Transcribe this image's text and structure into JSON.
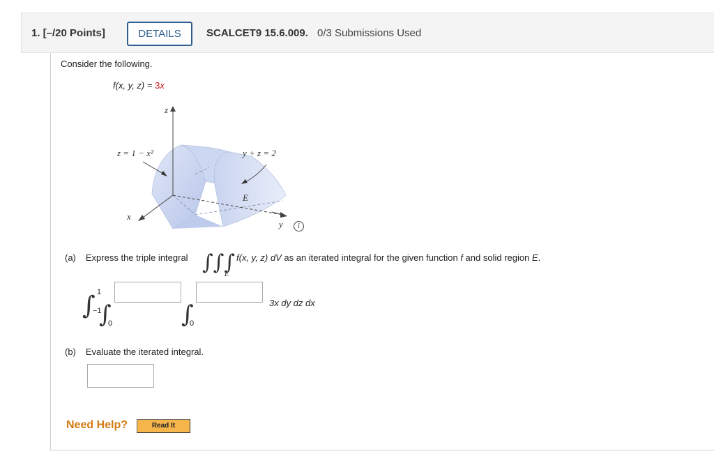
{
  "header": {
    "question_number": "1.  [–/20 Points]",
    "details_label": "DETAILS",
    "problem_code": "SCALCET9 15.6.009.",
    "submissions": "0/3 Submissions Used"
  },
  "prompt": {
    "intro": "Consider the following.",
    "function_lhs": "f(x, y, z) = ",
    "function_coef": "3",
    "function_var": "x"
  },
  "figure": {
    "axis_z": "z",
    "axis_x": "x",
    "axis_y": "y",
    "surface1": "z = 1 − x²",
    "surface2": "y + z = 2",
    "region": "E",
    "info_icon": "info-icon"
  },
  "part_a": {
    "label": "(a)",
    "text_before": "Express the triple integral",
    "region_sub": "E",
    "text_after_italic": "f(x, y, z) dV",
    "text_after": " as an iterated integral for the given function ",
    "f": "f",
    "text_and": " and solid region ",
    "E": "E",
    "period": ".",
    "outer_upper": "1",
    "outer_lower": "−1",
    "middle_lower": "0",
    "inner_lower": "0",
    "integrand": "3x dy dz dx",
    "middle_upper_value": "",
    "inner_upper_value": ""
  },
  "part_b": {
    "label": "(b)",
    "text": "Evaluate the iterated integral.",
    "answer_value": ""
  },
  "help": {
    "need_help": "Need Help?",
    "read_it": "Read It"
  },
  "colors": {
    "accent_blue": "#2f5f8f",
    "red": "#c4201c",
    "help_orange": "#d47a12",
    "read_it_bg": "#f5b54b"
  }
}
